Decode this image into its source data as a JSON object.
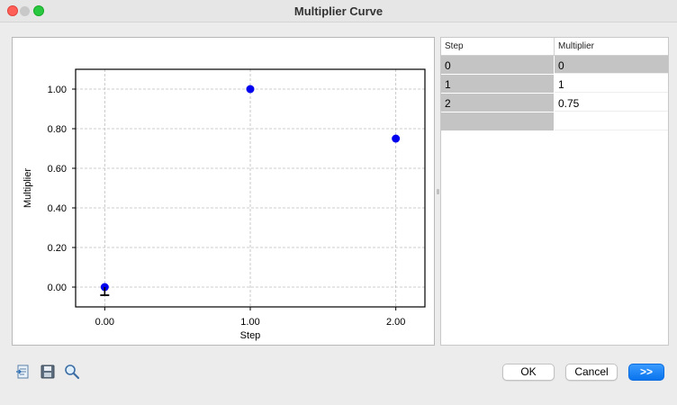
{
  "window": {
    "title": "Multiplier Curve"
  },
  "chart_data": {
    "type": "scatter",
    "x": [
      0,
      1,
      2
    ],
    "y": [
      0,
      1,
      0.75
    ],
    "xlabel": "Step",
    "ylabel": "Multiplier",
    "xlim": [
      -0.2,
      2.2
    ],
    "ylim": [
      -0.1,
      1.1
    ],
    "xticks": [
      0,
      1,
      2
    ],
    "xtick_labels": [
      "0.00",
      "1.00",
      "2.00"
    ],
    "yticks": [
      0,
      0.2,
      0.4,
      0.6,
      0.8,
      1.0
    ],
    "ytick_labels": [
      "0.00",
      "0.20",
      "0.40",
      "0.60",
      "0.80",
      "1.00"
    ],
    "grid": true,
    "point_color": "#0000ee"
  },
  "table": {
    "headers": [
      "Step",
      "Multiplier"
    ],
    "rows": [
      [
        "0",
        "0"
      ],
      [
        "1",
        "1"
      ],
      [
        "2",
        "0.75"
      ],
      [
        "",
        ""
      ]
    ]
  },
  "toolbar": {
    "icons": [
      "export-icon",
      "save-icon",
      "zoom-icon"
    ]
  },
  "buttons": {
    "ok": "OK",
    "cancel": "Cancel",
    "next": ">>"
  }
}
